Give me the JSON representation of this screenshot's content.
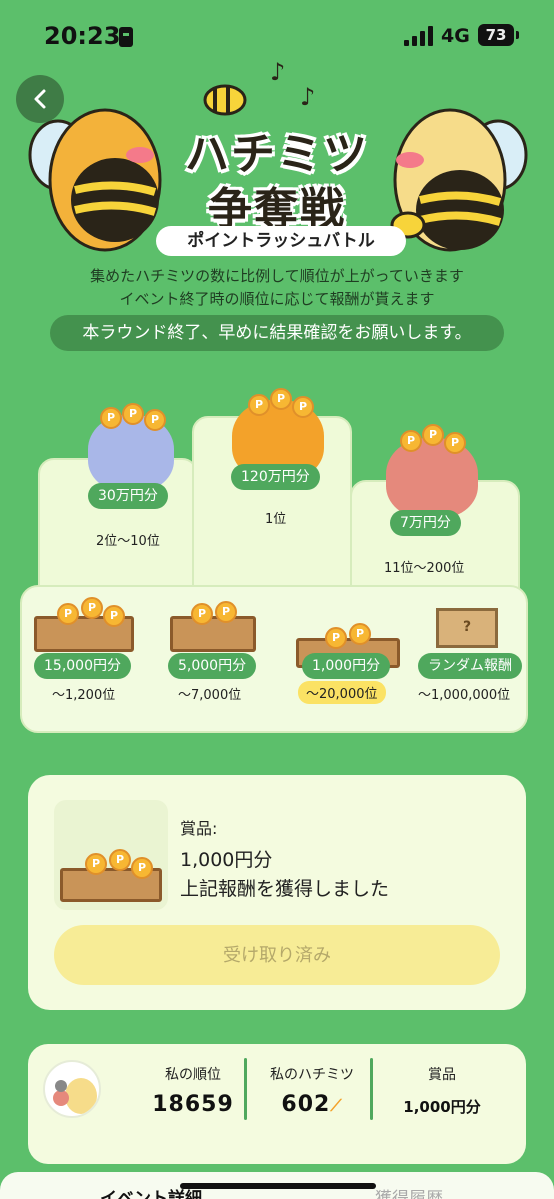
{
  "status_bar": {
    "time": "20:23",
    "network": "4G",
    "battery": "73"
  },
  "banner": {
    "title_line1": "ハチミツ",
    "title_line2": "争奪戦",
    "subtitle": "ポイントラッシュバトル"
  },
  "description": {
    "line1": "集めたハチミツの数に比例して順位が上がっていきます",
    "line2": "イベント終了時の順位に応じて報酬が貰えます"
  },
  "notice": "本ラウンド終了、早めに結果確認をお願いします。",
  "podium": [
    {
      "prize": "120万円分",
      "rank": "1位"
    },
    {
      "prize": "30万円分",
      "rank": "2位〜10位"
    },
    {
      "prize": "7万円分",
      "rank": "11位〜200位"
    }
  ],
  "lower_tiers": [
    {
      "prize": "15,000円分",
      "rank": "〜1,200位"
    },
    {
      "prize": "5,000円分",
      "rank": "〜7,000位"
    },
    {
      "prize": "1,000円分",
      "rank": "〜20,000位"
    },
    {
      "prize": "ランダム報酬",
      "rank": "〜1,000,000位"
    }
  ],
  "reward": {
    "label": "賞品:",
    "value": "1,000円分",
    "message": "上記報酬を獲得しました",
    "button": "受け取り済み"
  },
  "summary": {
    "rank_label": "私の順位",
    "rank_value": "18659",
    "honey_label": "私のハチミツ",
    "honey_value": "602",
    "prize_label": "賞品",
    "prize_value": "1,000円分"
  },
  "tabs": {
    "active": "イベント詳細",
    "inactive": "獲得履歴"
  },
  "colors": {
    "background": "#5cbf6b",
    "accent": "#4fa85d",
    "highlight": "#fbe264"
  }
}
